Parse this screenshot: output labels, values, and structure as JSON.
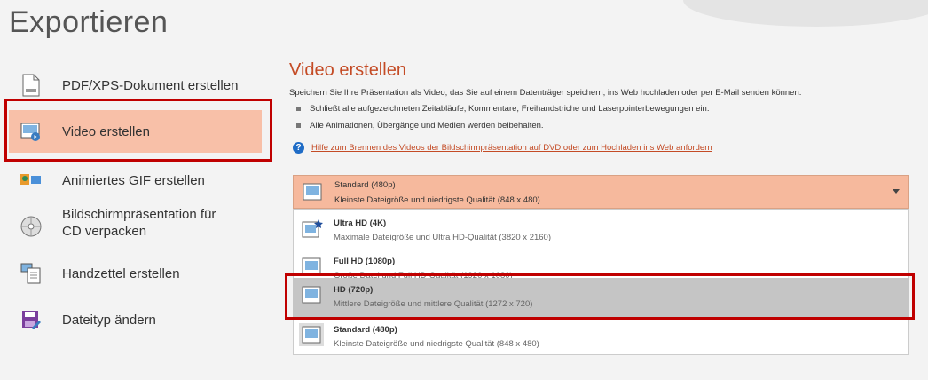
{
  "page": {
    "title": "Exportieren"
  },
  "menu": [
    {
      "label": "PDF/XPS-Dokument erstellen",
      "icon": "pdf-document-icon"
    },
    {
      "label": "Video erstellen",
      "icon": "video-icon",
      "active": true
    },
    {
      "label": "Animiertes GIF erstellen",
      "icon": "gif-icon"
    },
    {
      "label": "Bildschirmpräsentation für CD verpacken",
      "icon": "cd-icon"
    },
    {
      "label": "Handzettel erstellen",
      "icon": "handout-icon"
    },
    {
      "label": "Dateityp ändern",
      "icon": "save-as-icon"
    }
  ],
  "content": {
    "title": "Video erstellen",
    "description": "Speichern Sie Ihre Präsentation als Video, das Sie auf einem Datenträger speichern, ins Web hochladen oder per E-Mail senden können.",
    "bullets": [
      "Schließt alle aufgezeichneten Zeitabläufe, Kommentare, Freihandstriche und Laserpointerbewegungen ein.",
      "Alle Animationen, Übergänge und Medien werden beibehalten."
    ],
    "help_link": "Hilfe zum Brennen des Videos der Bildschirmpräsentation auf DVD oder zum Hochladen ins Web anfordern"
  },
  "dropdown": {
    "selected_title": "Standard (480p)",
    "selected_desc": "Kleinste Dateigröße und niedrigste Qualität (848 x 480)",
    "options": [
      {
        "title": "Ultra HD (4K)",
        "desc": "Maximale Dateigröße und Ultra HD-Qualität (3820 x 2160)"
      },
      {
        "title": "Full HD (1080p)",
        "desc": "Große Datei und Full HD-Qualität (1920 x 1080)"
      },
      {
        "title": "HD (720p)",
        "desc": "Mittlere Dateigröße und mittlere Qualität (1272 x 720)",
        "highlighted": true
      },
      {
        "title": "Standard (480p)",
        "desc": "Kleinste Dateigröße und niedrigste Qualität (848 x 480)"
      }
    ]
  },
  "colors": {
    "accent": "#c44b25",
    "active_bg": "#f8c0a8",
    "annotation_red": "#c00000"
  }
}
